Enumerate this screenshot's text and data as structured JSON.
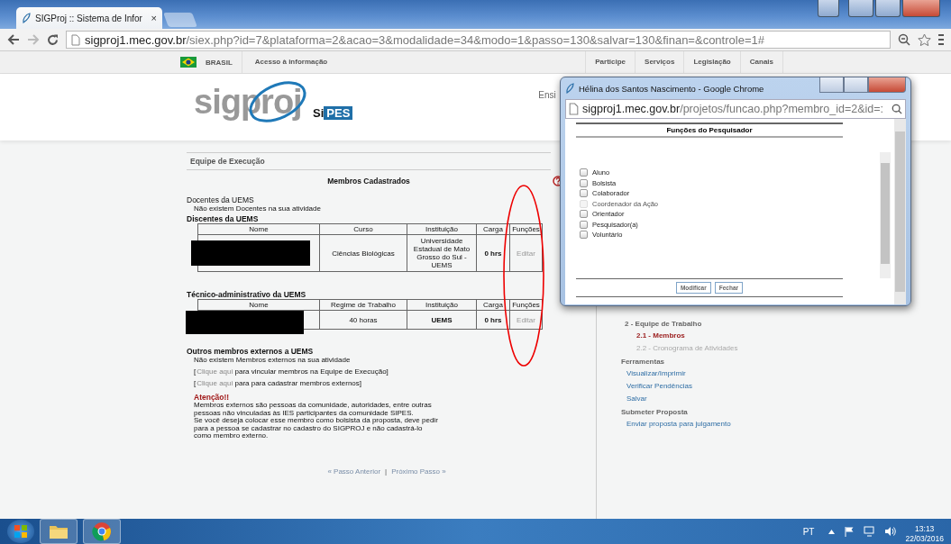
{
  "browser": {
    "tab_title": "SIGProj :: Sistema de Infor",
    "tab_close": "×",
    "url_host": "sigproj1.mec.gov.br",
    "url_path": "/siex.php?id=7&plataforma=2&acao=3&modalidade=34&modo=1&passo=130&salvar=130&finan=&controle=1#"
  },
  "gov_bar": {
    "country": "BRASIL",
    "access_link": "Acesso à informação",
    "menu": [
      "Participe",
      "Serviços",
      "Legislação",
      "Canais"
    ]
  },
  "header": {
    "logo": "sigproj",
    "sublogo_prefix": "Si",
    "sublogo": "PES",
    "cut_link": "Ensi"
  },
  "section_title": "Equipe de Execução",
  "members_title": "Membros Cadastrados",
  "docentes": {
    "heading": "Docentes da UEMS",
    "message": "Não existem Docentes na sua atividade"
  },
  "discentes": {
    "heading": "Discentes da UEMS",
    "columns": [
      "Nome",
      "Curso",
      "Instituição",
      "Carga",
      "Funções"
    ],
    "rows": [
      {
        "course": "Ciências Biológicas",
        "institution": "Universidade Estadual de Mato Grosso do Sul - UEMS",
        "load": "0 hrs",
        "action": "Editar"
      }
    ]
  },
  "tecnicos": {
    "heading": "Técnico-administrativo da UEMS",
    "columns": [
      "Nome",
      "Regime de Trabalho",
      "Instituição",
      "Carga",
      "Funções"
    ],
    "rows": [
      {
        "course": "40 horas",
        "institution": "UEMS",
        "load": "0 hrs",
        "action": "Editar"
      }
    ]
  },
  "externos": {
    "heading": "Outros membros externos a UEMS",
    "message": "Não existem Membros externos na sua atividade",
    "links": [
      {
        "open": "[",
        "link": "Clique aqui",
        "rest": "para vincular membros na Equipe de Execução]"
      },
      {
        "open": "[",
        "link": "Clique aqui",
        "rest": "para para cadastrar membros externos]"
      }
    ],
    "warning_title": "Atenção!!",
    "warning_lines": [
      "Membros externos são pessoas da comunidade, autoridades, entre outras",
      "pessoas não vinculadas às IES participantes da comunidade SIPES.",
      "Se você deseja colocar esse membro como bolsista da proposta, deve pedir",
      "para a pessoa se cadastrar no cadastro do SIGPROJ e não cadastrá-lo",
      "como membro externo."
    ]
  },
  "pager": {
    "previous": "« Passo Anterior",
    "separator": "|",
    "next": "Próximo Passo »"
  },
  "sidebar": {
    "steps": [
      {
        "label": "2 - Equipe de Trabalho",
        "children": [
          {
            "label": "2.1 - Membros",
            "selected": true,
            "disabled": false
          },
          {
            "label": "2.2 - Cronograma de Atividades",
            "selected": false,
            "disabled": true
          }
        ]
      }
    ],
    "sections": [
      {
        "title": "Ferramentas",
        "links": [
          "Visualizar/Imprimir",
          "Verificar Pendências",
          "Salvar"
        ]
      },
      {
        "title": "Submeter Proposta",
        "links": [
          "Enviar proposta para julgamento"
        ]
      }
    ]
  },
  "popup": {
    "title": "Hélina dos Santos Nascimento - Google Chrome",
    "url_host": "sigproj1.mec.gov.br",
    "url_path": "/projetos/funcao.php?membro_id=2&id=:",
    "heading": "Funções do Pesquisador",
    "options": [
      {
        "label": "Aluno",
        "checked": false,
        "disabled": false
      },
      {
        "label": "Bolsista",
        "checked": false,
        "disabled": false
      },
      {
        "label": "Colaborador",
        "checked": false,
        "disabled": false
      },
      {
        "label": "Coordenador da Ação",
        "checked": false,
        "disabled": true
      },
      {
        "label": "Orientador",
        "checked": false,
        "disabled": false
      },
      {
        "label": "Pesquisador(a)",
        "checked": false,
        "disabled": false
      },
      {
        "label": "Voluntário",
        "checked": false,
        "disabled": false
      }
    ],
    "buttons": [
      "Modificar",
      "Fechar"
    ]
  },
  "taskbar": {
    "language": "PT",
    "time": "13:13",
    "date": "22/03/2016"
  }
}
